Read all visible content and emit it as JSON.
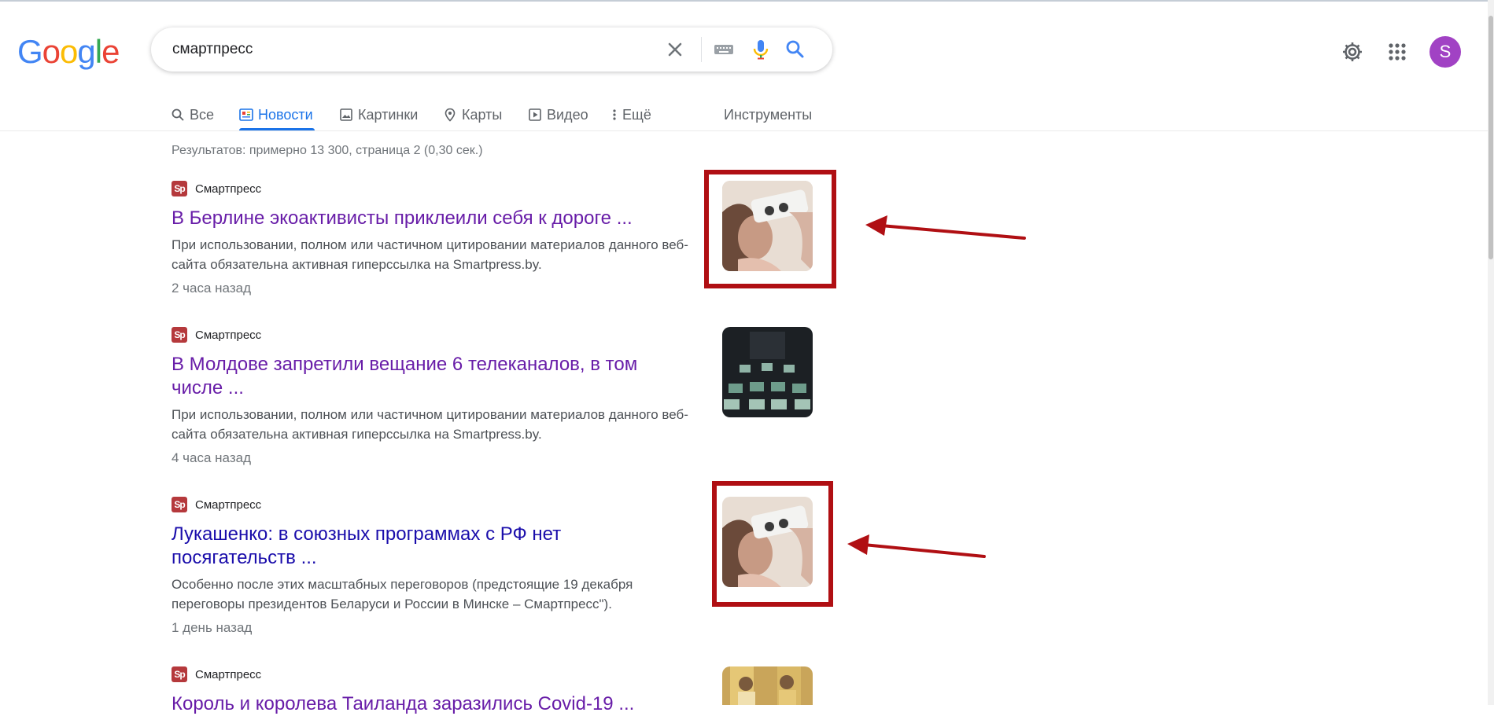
{
  "logo": {
    "letters": [
      "G",
      "o",
      "o",
      "g",
      "l",
      "e"
    ],
    "colors": [
      "#4285f4",
      "#ea4335",
      "#fbbc05",
      "#4285f4",
      "#34a853",
      "#ea4335"
    ]
  },
  "search": {
    "query": "смартпресс"
  },
  "user": {
    "avatar_letter": "S",
    "avatar_color": "#a142c4"
  },
  "tabs": [
    {
      "label": "Все",
      "icon": "search-icon",
      "active": false
    },
    {
      "label": "Новости",
      "icon": "news-icon",
      "active": true
    },
    {
      "label": "Картинки",
      "icon": "image-icon",
      "active": false
    },
    {
      "label": "Карты",
      "icon": "map-pin-icon",
      "active": false
    },
    {
      "label": "Видео",
      "icon": "play-icon",
      "active": false
    },
    {
      "label": "Ещё",
      "icon": "more-vert-icon",
      "active": false
    }
  ],
  "tools_label": "Инструменты",
  "stats": "Результатов: примерно 13 300, страница 2 (0,30 сек.)",
  "results": [
    {
      "source": "Смартпресс",
      "favicon_text": "Sp",
      "title": "В Берлине экоактивисты приклеили себя к дороге ...",
      "snippet": "При использовании, полном или частичном цитировании материалов данного веб-сайта обязательна активная гиперссылка на Smartpress.by.",
      "age": "2 часа назад",
      "visited": true
    },
    {
      "source": "Смартпресс",
      "favicon_text": "Sp",
      "title": "В Молдове запретили вещание 6 телеканалов, в том числе ...",
      "snippet": "При использовании, полном или частичном цитировании материалов данного веб-сайта обязательна активная гиперссылка на Smartpress.by.",
      "age": "4 часа назад",
      "visited": true
    },
    {
      "source": "Смартпресс",
      "favicon_text": "Sp",
      "title": "Лукашенко: в союзных программах с РФ нет посягательств ...",
      "snippet": "Особенно после этих масштабных переговоров (предстоящие 19 декабря переговоры президентов Беларуси и России в Минске – Смартпресс\").",
      "age": "1 день назад",
      "visited": false
    },
    {
      "source": "Смартпресс",
      "favicon_text": "Sp",
      "title": "Король и королева Таиланда заразились Covid-19 ...",
      "visited": true
    }
  ],
  "colors": {
    "annotation_red": "#b00f13",
    "link_visited": "#681da8",
    "link": "#1a0dab",
    "accent": "#1a73e8"
  }
}
